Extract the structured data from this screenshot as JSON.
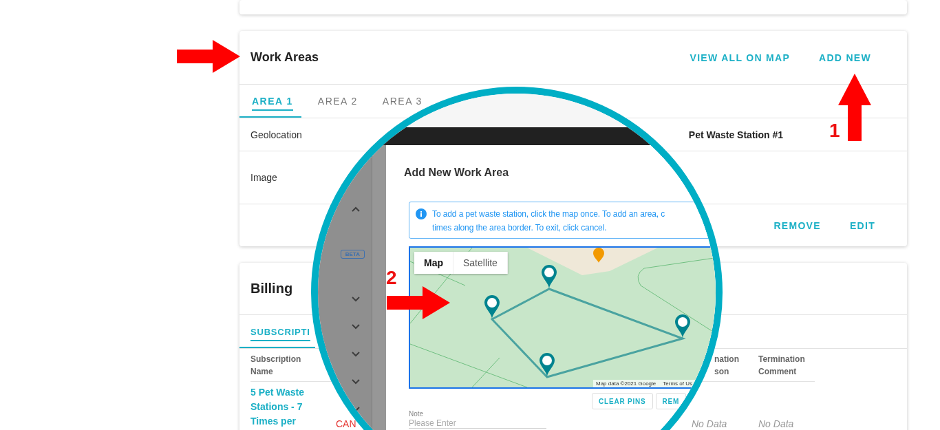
{
  "work_areas": {
    "title": "Work Areas",
    "actions": [
      "VIEW ALL ON MAP",
      "ADD NEW"
    ],
    "tabs": [
      {
        "label": "AREA 1",
        "selected": true
      },
      {
        "label": "AREA 2",
        "selected": false
      },
      {
        "label": "AREA 3",
        "selected": false
      }
    ],
    "rows": [
      {
        "label": "Geolocation",
        "value": "Pet Waste Station #1"
      },
      {
        "label": "Image"
      }
    ],
    "footer_actions": [
      "REMOVE",
      "EDIT"
    ]
  },
  "billing": {
    "title": "Billing",
    "tabs": [
      {
        "label": "SUBSCRIPTI",
        "selected": true
      }
    ],
    "columns": [
      {
        "header": "Subscription Name"
      },
      {},
      {
        "header": "nation son"
      },
      {
        "header": "Termination Comment"
      }
    ],
    "rows": [
      {
        "cells": [
          {
            "kind": "link",
            "text": "5 Pet Waste Stations - 7 Times per"
          },
          {
            "kind": "status",
            "text": "CAN"
          },
          {
            "kind": "empty",
            "text": "No Data"
          },
          {
            "kind": "empty",
            "text": "No Data"
          }
        ]
      }
    ]
  },
  "magnifier": {
    "sidebar": {
      "badge": "BETA",
      "chevrons": [
        {
          "expanded": true
        },
        {
          "expanded": false
        },
        {
          "expanded": false
        },
        {
          "expanded": false
        },
        {
          "expanded": false
        },
        {
          "expanded": false
        }
      ]
    },
    "dialog": {
      "title": "Add New Work Area",
      "info_lines": [
        "To add a pet waste station, click the map once. To add an area, c",
        "times along the area border. To exit, click cancel."
      ],
      "map": {
        "modes": [
          {
            "label": "Map",
            "selected": true
          },
          {
            "label": "Satellite",
            "selected": false
          }
        ],
        "attribution": [
          "Map data ©2021 Google",
          "Terms of Us"
        ]
      },
      "buttons": [
        "CLEAR PINS",
        "REM"
      ],
      "note": {
        "label": "Note",
        "placeholder": "Please Enter"
      }
    }
  },
  "annotations": [
    {
      "kind": "right"
    },
    {
      "kind": "up",
      "number": "1"
    },
    {
      "kind": "right",
      "number": "2"
    }
  ]
}
